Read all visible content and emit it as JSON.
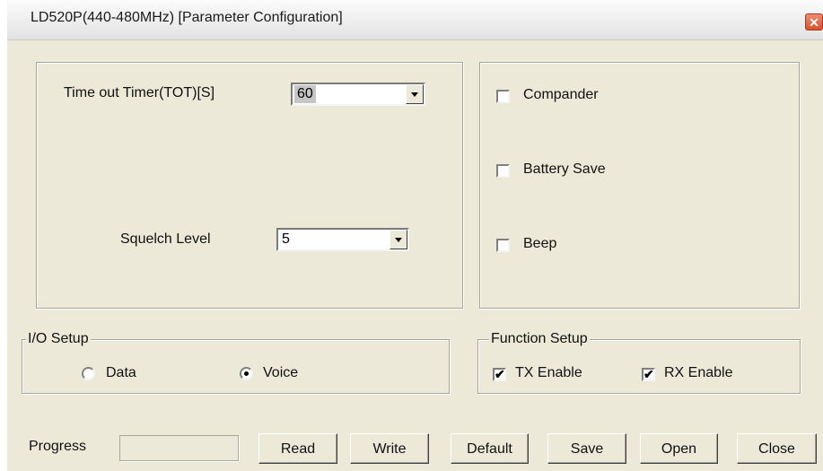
{
  "window": {
    "title": "LD520P(440-480MHz) [Parameter Configuration]",
    "close_glyph": "✕"
  },
  "tot": {
    "label": "Time out Timer(TOT)[S]",
    "value": "60"
  },
  "squelch": {
    "label": "Squelch Level",
    "value": "5"
  },
  "options": {
    "compander": {
      "label": "Compander",
      "checked": false
    },
    "battery_save": {
      "label": "Battery Save",
      "checked": false
    },
    "beep": {
      "label": "Beep",
      "checked": false
    }
  },
  "io_setup": {
    "legend": "I/O Setup",
    "data_label": "Data",
    "voice_label": "Voice",
    "selected": "Voice"
  },
  "function_setup": {
    "legend": "Function Setup",
    "tx_label": "TX Enable",
    "tx_checked": true,
    "rx_label": "RX Enable",
    "rx_checked": true,
    "check_glyph": "✔"
  },
  "progress": {
    "label": "Progress",
    "value": 0
  },
  "buttons": {
    "read": "Read",
    "write": "Write",
    "default": "Default",
    "save": "Save",
    "open": "Open",
    "close": "Close"
  }
}
